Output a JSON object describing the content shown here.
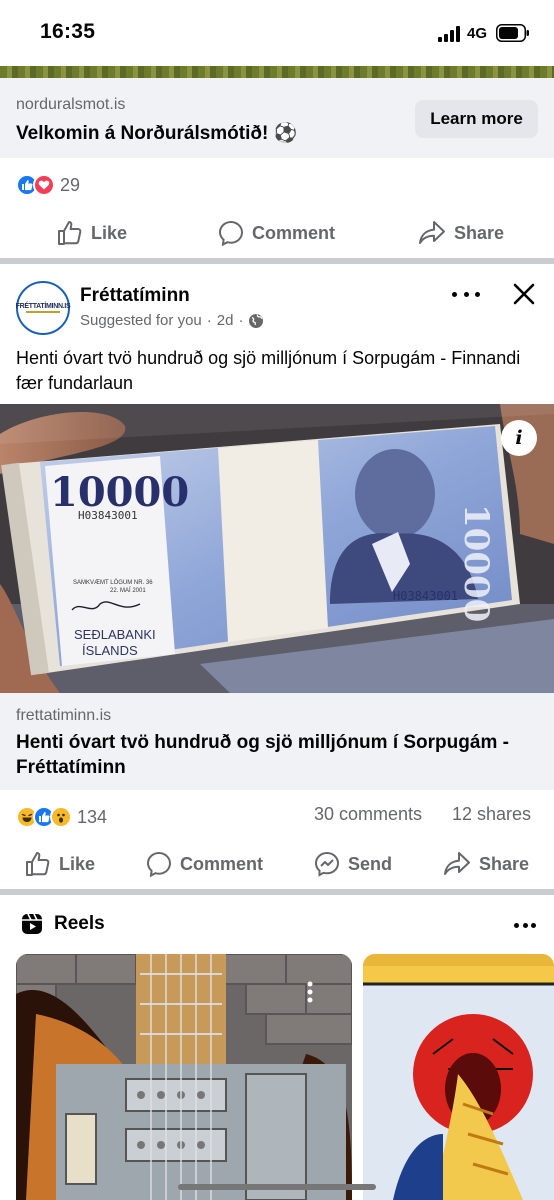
{
  "status_bar": {
    "time": "16:35",
    "network": "4G"
  },
  "ad": {
    "domain": "norduralsmot.is",
    "title": "Velkomin á Norðurálsmótið! ⚽",
    "cta_label": "Learn more",
    "reaction_icons": [
      "like-reaction",
      "love-reaction"
    ],
    "reaction_count": "29",
    "actions": {
      "like": "Like",
      "comment": "Comment",
      "share": "Share"
    }
  },
  "post": {
    "avatar_text": "FRÉTTATÍMINN.IS",
    "page_name": "Fréttatíminn",
    "suggested_label": "Suggested for you",
    "dot": "·",
    "time": "2d",
    "text": "Henti óvart tvö hundruð og sjö milljónum í Sorpugám - Finnandi fær fundarlaun",
    "image": {
      "banknote_value": "10000",
      "serial": "H03843001",
      "law_text_1": "SAMKVÆMT LÖGUM NR. 36",
      "law_text_2": "22. MAÍ 2001",
      "bank_name_1": "SEÐLABANKI",
      "bank_name_2": "ÍSLANDS",
      "info_symbol": "i"
    },
    "link_domain": "frettatiminn.is",
    "link_title": "Henti óvart tvö hundruð og sjö milljónum í Sorpugám - Fréttatíminn",
    "reaction_icons": [
      "haha-reaction",
      "like-reaction",
      "wow-reaction"
    ],
    "reaction_count": "134",
    "comments": "30 comments",
    "shares": "12 shares",
    "actions": {
      "like": "Like",
      "comment": "Comment",
      "send": "Send",
      "share": "Share"
    }
  },
  "reels": {
    "title": "Reels"
  },
  "colors": {
    "facebook_blue": "#1877f2",
    "secondary_text": "#65676b",
    "love_red": "#f33e58",
    "reaction_yellow": "#f7b928",
    "card_footer_bg": "#f0f2f5"
  }
}
